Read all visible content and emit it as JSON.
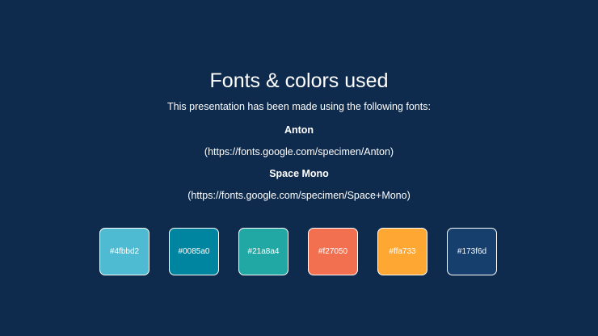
{
  "title": "Fonts & colors used",
  "intro": "This presentation has been made using the following fonts:",
  "fonts": [
    {
      "name": "Anton",
      "url": "(https://fonts.google.com/specimen/Anton)"
    },
    {
      "name": "Space Mono",
      "url": "(https://fonts.google.com/specimen/Space+Mono)"
    }
  ],
  "colors": [
    {
      "label": "#4fbbd2",
      "hex": "#4fbbd2"
    },
    {
      "label": "#0085a0",
      "hex": "#0085a0"
    },
    {
      "label": "#21a8a4",
      "hex": "#21a8a4"
    },
    {
      "label": "#f27050",
      "hex": "#f27050"
    },
    {
      "label": "#ffa733",
      "hex": "#ffa733"
    },
    {
      "label": "#173f6d",
      "hex": "#173f6d"
    }
  ],
  "background_color": "#0e2b4e"
}
